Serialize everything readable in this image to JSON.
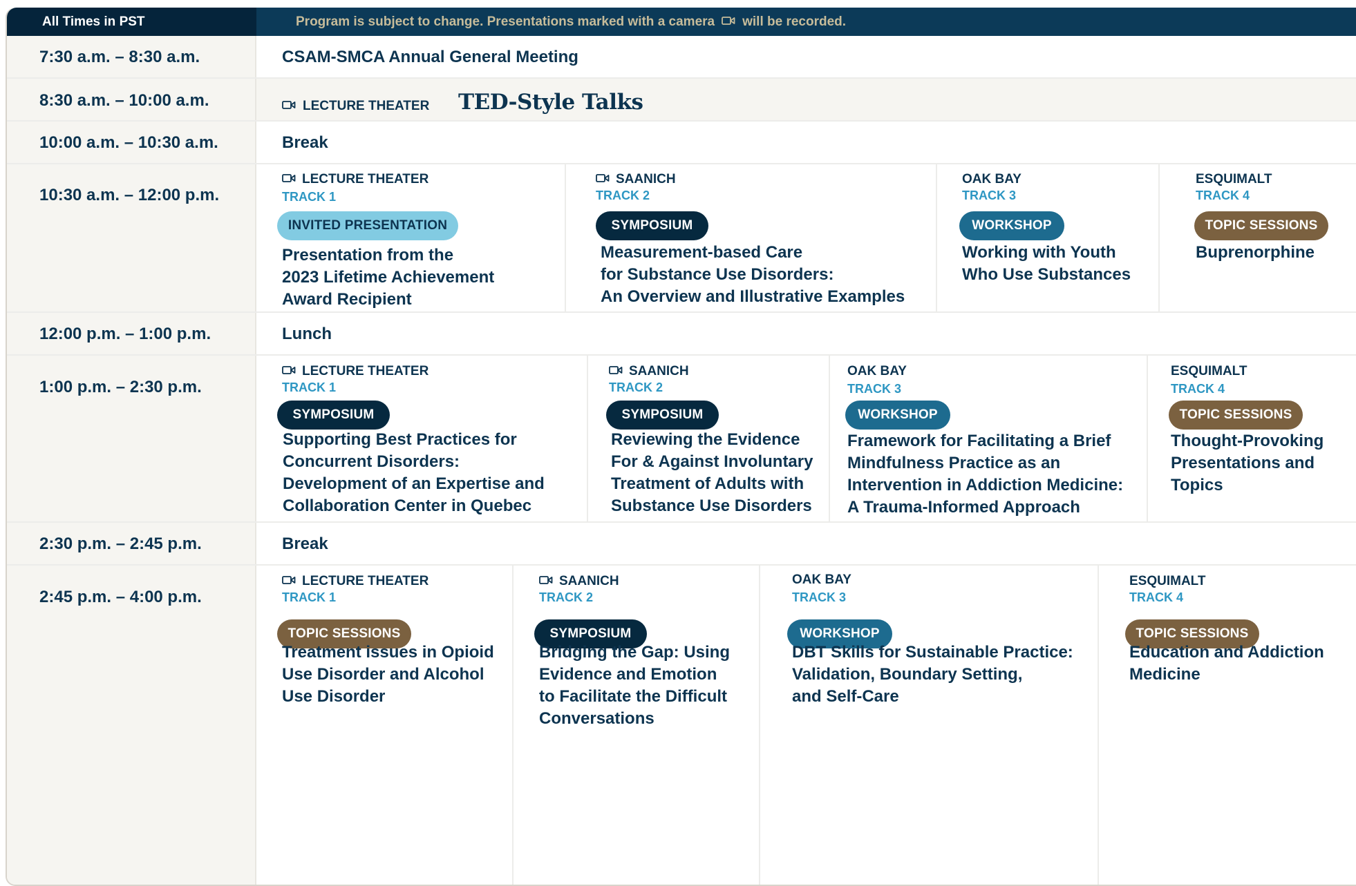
{
  "header": {
    "timezone": "All Times in PST",
    "notice_before": "Program is subject to change.  Presentations marked with a camera",
    "notice_after": "will be recorded."
  },
  "rows": [
    {
      "time": "7:30 a.m. – 8:30 a.m.",
      "text": "CSAM-SMCA Annual General Meeting"
    },
    {
      "time": "8:30 a.m. – 10:00 a.m.",
      "location": "LECTURE THEATER",
      "title": "TED-Style Talks"
    },
    {
      "time": "10:00 a.m. – 10:30 a.m.",
      "text": "Break"
    },
    {
      "time": "10:30 a.m. – 12:00 p.m.",
      "sessions": [
        {
          "location": "LECTURE THEATER",
          "recorded": true,
          "track": "TRACK 1",
          "type": "INVITED PRESENTATION",
          "title_lines": [
            "Presentation from the",
            "2023 Lifetime Achievement",
            "Award Recipient"
          ]
        },
        {
          "location": "SAANICH",
          "recorded": true,
          "track": "TRACK 2",
          "type": "SYMPOSIUM",
          "title_lines": [
            "Measurement-based Care",
            "for Substance Use Disorders:",
            "An Overview and Illustrative Examples"
          ]
        },
        {
          "location": "OAK BAY",
          "recorded": false,
          "track": "TRACK 3",
          "type": "WORKSHOP",
          "title_lines": [
            "Working with Youth",
            "Who Use Substances"
          ]
        },
        {
          "location": "ESQUIMALT",
          "recorded": false,
          "track": "TRACK 4",
          "type": "TOPIC SESSIONS",
          "title_lines": [
            "Buprenorphine"
          ]
        }
      ]
    },
    {
      "time": "12:00 p.m. – 1:00 p.m.",
      "text": "Lunch"
    },
    {
      "time": "1:00 p.m. – 2:30 p.m.",
      "sessions": [
        {
          "location": "LECTURE THEATER",
          "recorded": true,
          "track": "TRACK 1",
          "type": "SYMPOSIUM",
          "title_lines": [
            "Supporting Best Practices for",
            "Concurrent Disorders:",
            "Development of an Expertise and",
            "Collaboration Center in Quebec"
          ]
        },
        {
          "location": "SAANICH",
          "recorded": true,
          "track": "TRACK 2",
          "type": "SYMPOSIUM",
          "title_lines": [
            "Reviewing the Evidence",
            "For & Against Involuntary",
            "Treatment of Adults with",
            "Substance Use Disorders"
          ]
        },
        {
          "location": "OAK BAY",
          "recorded": false,
          "track": "TRACK 3",
          "type": "WORKSHOP",
          "title_lines": [
            "Framework for Facilitating a Brief",
            "Mindfulness Practice as an",
            "Intervention in Addiction Medicine:",
            "A Trauma-Informed Approach"
          ]
        },
        {
          "location": "ESQUIMALT",
          "recorded": false,
          "track": "TRACK 4",
          "type": "TOPIC SESSIONS",
          "title_lines": [
            "Thought-Provoking",
            "Presentations and",
            "Topics"
          ]
        }
      ]
    },
    {
      "time": "2:30 p.m. – 2:45 p.m.",
      "text": "Break"
    },
    {
      "time": "2:45 p.m. – 4:00 p.m.",
      "sessions": [
        {
          "location": "LECTURE THEATER",
          "recorded": true,
          "track": "TRACK 1",
          "type": "TOPIC SESSIONS",
          "title_lines": [
            "Treatment issues in Opioid",
            "Use Disorder and Alcohol",
            "Use Disorder"
          ]
        },
        {
          "location": "SAANICH",
          "recorded": true,
          "track": "TRACK 2",
          "type": "SYMPOSIUM",
          "title_lines": [
            "Bridging the Gap: Using",
            "Evidence and Emotion",
            "to Facilitate the Difficult",
            "Conversations"
          ]
        },
        {
          "location": "OAK BAY",
          "recorded": false,
          "track": "TRACK 3",
          "type": "WORKSHOP",
          "title_lines": [
            "DBT Skills for Sustainable Practice:",
            "Validation, Boundary Setting,",
            "and Self-Care"
          ]
        },
        {
          "location": "ESQUIMALT",
          "recorded": false,
          "track": "TRACK 4",
          "type": "TOPIC SESSIONS",
          "title_lines": [
            "Education and Addiction",
            "Medicine"
          ]
        }
      ]
    }
  ],
  "icons": {
    "recorded": "camera-icon"
  },
  "colors": {
    "header_bg": "#0c3a58",
    "header_left_bg": "#05243b",
    "text": "#0d3450",
    "track": "#2e97c3",
    "invited": "#82cbe2",
    "symposium": "#06293f",
    "workshop": "#1d6b8f",
    "topic": "#7b6140"
  }
}
